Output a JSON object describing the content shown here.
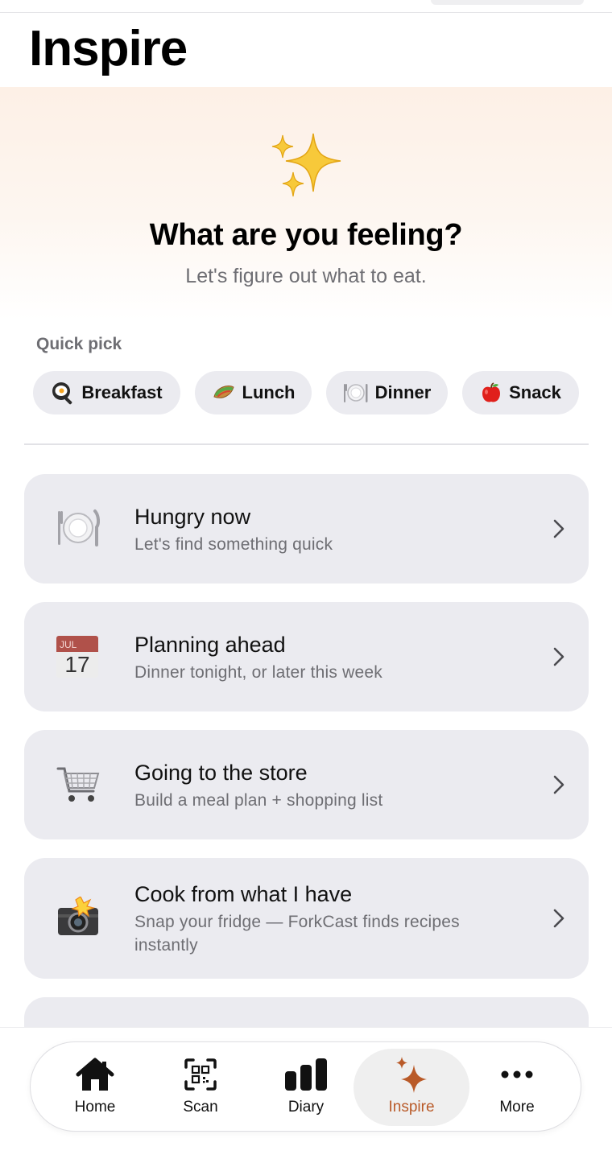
{
  "page": {
    "title": "Inspire"
  },
  "hero": {
    "icon": "sparkles-icon",
    "title": "What are you feeling?",
    "subtitle": "Let's figure out what to eat."
  },
  "quick_pick": {
    "label": "Quick pick",
    "chips": [
      {
        "icon": "frying-pan-egg-icon",
        "label": "Breakfast"
      },
      {
        "icon": "wrap-icon",
        "label": "Lunch"
      },
      {
        "icon": "plate-cutlery-icon",
        "label": "Dinner"
      },
      {
        "icon": "red-apple-icon",
        "label": "Snack"
      }
    ]
  },
  "options": [
    {
      "icon": "plate-cutlery-icon",
      "title": "Hungry now",
      "subtitle": "Let's find something quick"
    },
    {
      "icon": "calendar-icon",
      "calendar_month": "JUL",
      "calendar_day": "17",
      "title": "Planning ahead",
      "subtitle": "Dinner tonight, or later this week"
    },
    {
      "icon": "shopping-cart-icon",
      "title": "Going to the store",
      "subtitle": "Build a meal plan + shopping list"
    },
    {
      "icon": "camera-flash-icon",
      "title": "Cook from what I have",
      "subtitle": "Snap your fridge — ForkCast finds recipes instantly"
    }
  ],
  "tab_bar": {
    "active": "Inspire",
    "accent_color": "#b95a28",
    "items": [
      {
        "icon": "home-icon",
        "label": "Home"
      },
      {
        "icon": "qr-scan-icon",
        "label": "Scan"
      },
      {
        "icon": "bar-chart-icon",
        "label": "Diary"
      },
      {
        "icon": "sparkles-icon",
        "label": "Inspire"
      },
      {
        "icon": "more-dots-icon",
        "label": "More"
      }
    ]
  }
}
